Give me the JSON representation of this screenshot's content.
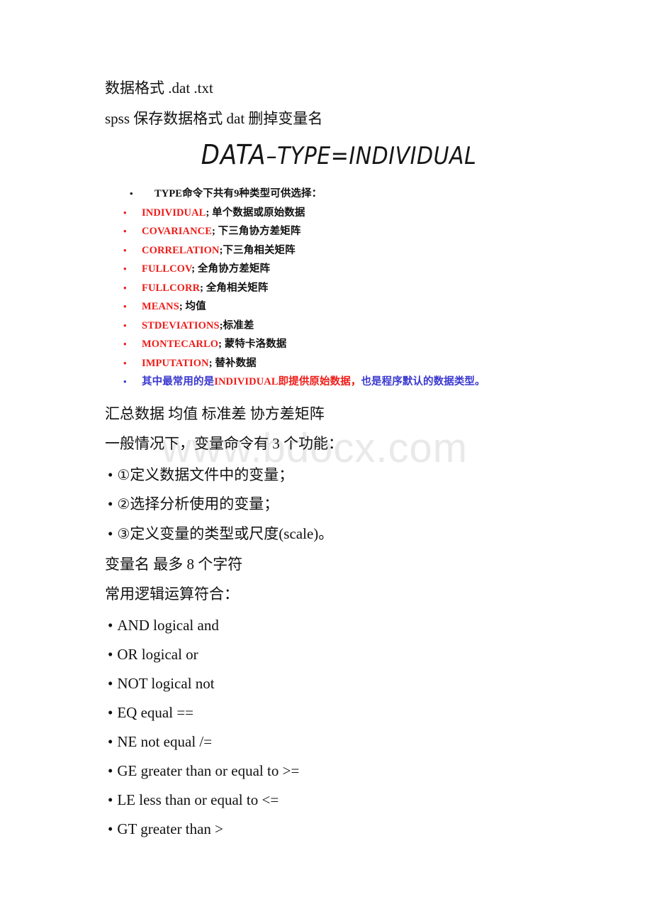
{
  "document": {
    "watermark": "www.bdocx.com",
    "colors": {
      "text": "#111111",
      "red": "#ee1c18",
      "blue": "#3a38cf",
      "watermark": "#e9e9e9"
    },
    "intro_lines": [
      {
        "text": "数据格式 .dat .txt"
      },
      {
        "text": "spss 保存数据格式 dat 删掉变量名"
      }
    ],
    "after_slide_lines": [
      {
        "text": "汇总数据 均值 标准差 协方差矩阵"
      },
      {
        "text": "一般情况下，变量命令有 3 个功能："
      }
    ],
    "numbered_items": [
      {
        "bullet": "•",
        "number": "①",
        "text": "定义数据文件中的变量；"
      },
      {
        "bullet": "•",
        "number": "②",
        "text": "选择分析使用的变量；"
      },
      {
        "bullet": "•",
        "number": "③",
        "text": "定义变量的类型或尺度(scale)。"
      }
    ],
    "mid_lines": [
      {
        "text": "变量名 最多 8 个字符"
      },
      {
        "text": "常用逻辑运算符合："
      }
    ],
    "operators": [
      {
        "bullet": "•",
        "text": "AND logical and"
      },
      {
        "bullet": "•",
        "text": "OR logical or"
      },
      {
        "bullet": "•",
        "text": "NOT logical not"
      },
      {
        "bullet": "•",
        "text": "EQ equal =="
      },
      {
        "bullet": "•",
        "text": "NE not equal /="
      },
      {
        "bullet": "•",
        "text": "GE greater than or equal to >="
      },
      {
        "bullet": "•",
        "text": "LE less than or equal to <="
      },
      {
        "bullet": "•",
        "text": "GT greater than >"
      }
    ]
  },
  "slide": {
    "title_main": "DATA",
    "title_rest": "–TYPE=INDIVIDUAL",
    "title_full": "DATA–TYPE=INDIVIDUAL",
    "bullets": [
      {
        "bullet": "•",
        "color": "#111111",
        "keyword": "",
        "keyword_color": "#111111",
        "text": "TYPE命令下共有9种类型可供选择：",
        "first": true
      },
      {
        "bullet": "•",
        "color": "#ee1c18",
        "keyword": "INDIVIDUAL",
        "keyword_color": "#ee1c18",
        "text": "; 单个数据或原始数据"
      },
      {
        "bullet": "•",
        "color": "#ee1c18",
        "keyword": "COVARIANCE",
        "keyword_color": "#ee1c18",
        "text": "; 下三角协方差矩阵"
      },
      {
        "bullet": "•",
        "color": "#ee1c18",
        "keyword": "CORRELATION",
        "keyword_color": "#ee1c18",
        "text": ";下三角相关矩阵"
      },
      {
        "bullet": "•",
        "color": "#ee1c18",
        "keyword": "FULLCOV",
        "keyword_color": "#ee1c18",
        "text": "; 全角协方差矩阵"
      },
      {
        "bullet": "•",
        "color": "#ee1c18",
        "keyword": "FULLCORR",
        "keyword_color": "#ee1c18",
        "text": "; 全角相关矩阵"
      },
      {
        "bullet": "•",
        "color": "#ee1c18",
        "keyword": "MEANS",
        "keyword_color": "#ee1c18",
        "text": "; 均值"
      },
      {
        "bullet": "•",
        "color": "#ee1c18",
        "keyword": "STDEVIATIONS",
        "keyword_color": "#ee1c18",
        "text": ";标准差"
      },
      {
        "bullet": "•",
        "color": "#ee1c18",
        "keyword": "MONTECARLO",
        "keyword_color": "#ee1c18",
        "text": "; 蒙特卡洛数据"
      },
      {
        "bullet": "•",
        "color": "#ee1c18",
        "keyword": "IMPUTATION",
        "keyword_color": "#ee1c18",
        "text": "; 替补数据"
      }
    ],
    "final_bullet": {
      "bullet": "•",
      "color": "#3a38cf",
      "part1": "其中最常用的是",
      "part1_color": "#3a38cf",
      "part2": "INDIVIDUAL即提供原始数据，",
      "part2_color": "#ee1c18",
      "part3": "也是程序默认的数据类型。",
      "part3_color": "#3a38cf"
    }
  }
}
